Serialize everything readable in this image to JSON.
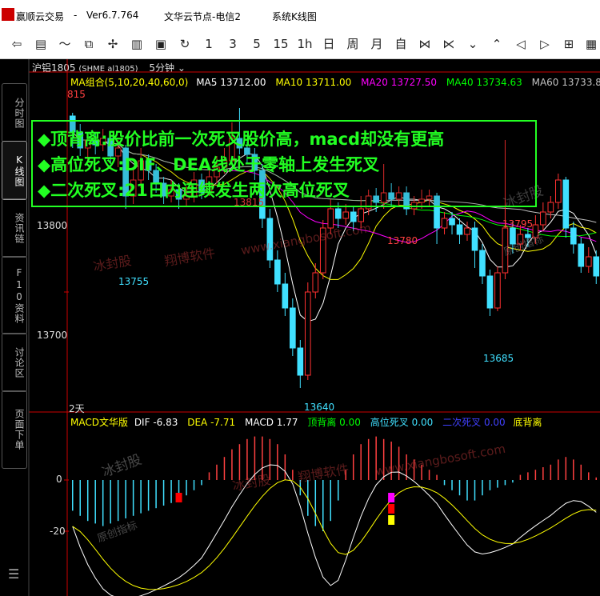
{
  "window": {
    "app_title": "赢顺云交易",
    "separator": "-",
    "version": "Ver6.7.764",
    "node": "文华云节点-电信2",
    "subtitle": "系统K线图"
  },
  "toolbar": {
    "items": [
      "back-icon",
      "list-icon",
      "line-icon",
      "candle-icon",
      "cross-icon",
      "bar-icon",
      "save-icon",
      "refresh-icon",
      "1",
      "3",
      "5",
      "15",
      "1h",
      "日",
      "周",
      "月",
      "自",
      "zoom-out-icon",
      "zoom-in-icon",
      "collapse-icon",
      "expand-icon",
      "left-icon",
      "right-icon",
      "grid-icon",
      "grid2-icon"
    ],
    "labels": {
      "p1": "1",
      "p3": "3",
      "p5": "5",
      "p15": "15",
      "p1h": "1h",
      "day": "日",
      "week": "周",
      "month": "月",
      "custom": "自"
    }
  },
  "sidebar": {
    "tabs": [
      {
        "label": "分时图"
      },
      {
        "label": "K线图"
      },
      {
        "label": "资讯链"
      },
      {
        "label": "F10资料"
      },
      {
        "label": "讨论区"
      },
      {
        "label": "页面下单"
      }
    ]
  },
  "contract": {
    "name": "沪铝1805",
    "code": "(SHME al1805)",
    "period": "5分钟"
  },
  "ma_header": {
    "group": "MA组合(5,10,20,40,60,0)",
    "ma5_label": "MA5",
    "ma5": "13712.00",
    "ma10_label": "MA10",
    "ma10": "13711.00",
    "ma20_label": "MA20",
    "ma20": "13727.50",
    "ma40_label": "MA40",
    "ma40": "13734.63",
    "ma60_label": "MA60",
    "ma60": "13733.83",
    "colors": {
      "ma5": "#ffffff",
      "ma10": "#ffff00",
      "ma20": "#ff00ff",
      "ma40": "#00ff00",
      "ma60": "#c0c0c0"
    }
  },
  "callout": {
    "line1": "◆顶背离:股价比前一次死叉股价高，macd却没有更高",
    "line2": "◆高位死叉:DIF、DEA线处于零轴上发生死叉",
    "line3": "◆二次死叉:21日内连续发生两次高位死叉"
  },
  "price_axis": {
    "tick1": "13800",
    "tick2": "13700"
  },
  "annotations": {
    "p1": "13755",
    "p2": "13815",
    "p3": "13780",
    "p4": "13795",
    "p5": "13685",
    "p6": "13640",
    "p0": "815",
    "days": "2天"
  },
  "watermark": {
    "brand": "冰封股",
    "sub": "翔博软件",
    "url": "www.xiangbosoft.com",
    "seal": "冰封股",
    "seal_sub": "原创指标"
  },
  "macd_header": {
    "name": "MACD文华版",
    "dif_label": "DIF",
    "dif": "-6.83",
    "dea_label": "DEA",
    "dea": "-7.71",
    "macd_label": "MACD",
    "macd": "1.77",
    "top_div_label": "顶背离",
    "top_div": "0.00",
    "high_death_label": "高位死叉",
    "high_death": "0.00",
    "second_death_label": "二次死叉",
    "second_death": "0.00",
    "bottom_div_label": "底背离"
  },
  "macd_axis": {
    "zero": "0",
    "neg20": "-20"
  },
  "chart_data": {
    "type": "candlestick",
    "ylim": [
      13630,
      13830
    ],
    "candles": [
      [
        13810,
        13800,
        13812,
        13790
      ],
      [
        13800,
        13790,
        13805,
        13785
      ],
      [
        13790,
        13795,
        13798,
        13782
      ],
      [
        13795,
        13792,
        13800,
        13786
      ],
      [
        13792,
        13796,
        13802,
        13788
      ],
      [
        13796,
        13785,
        13800,
        13780
      ],
      [
        13785,
        13790,
        13795,
        13778
      ],
      [
        13790,
        13760,
        13792,
        13752
      ],
      [
        13760,
        13770,
        13778,
        13755
      ],
      [
        13770,
        13782,
        13790,
        13765
      ],
      [
        13782,
        13776,
        13786,
        13770
      ],
      [
        13776,
        13768,
        13780,
        13762
      ],
      [
        13768,
        13760,
        13772,
        13755
      ],
      [
        13760,
        13764,
        13770,
        13756
      ],
      [
        13764,
        13758,
        13768,
        13752
      ],
      [
        13758,
        13760,
        13766,
        13754
      ],
      [
        13760,
        13770,
        13775,
        13756
      ],
      [
        13770,
        13762,
        13774,
        13758
      ],
      [
        13762,
        13772,
        13778,
        13760
      ],
      [
        13772,
        13778,
        13785,
        13768
      ],
      [
        13778,
        13782,
        13790,
        13774
      ],
      [
        13782,
        13796,
        13806,
        13780
      ],
      [
        13796,
        13790,
        13815,
        13786
      ],
      [
        13790,
        13786,
        13794,
        13780
      ],
      [
        13786,
        13776,
        13790,
        13770
      ],
      [
        13776,
        13746,
        13780,
        13740
      ],
      [
        13746,
        13720,
        13752,
        13715
      ],
      [
        13720,
        13705,
        13726,
        13700
      ],
      [
        13705,
        13690,
        13712,
        13685
      ],
      [
        13690,
        13665,
        13696,
        13660
      ],
      [
        13665,
        13648,
        13670,
        13640
      ],
      [
        13648,
        13700,
        13706,
        13645
      ],
      [
        13700,
        13712,
        13718,
        13696
      ],
      [
        13712,
        13740,
        13745,
        13708
      ],
      [
        13740,
        13752,
        13758,
        13736
      ],
      [
        13752,
        13746,
        13756,
        13740
      ],
      [
        13746,
        13750,
        13755,
        13742
      ],
      [
        13750,
        13744,
        13754,
        13738
      ],
      [
        13744,
        13752,
        13760,
        13740
      ],
      [
        13752,
        13760,
        13764,
        13748
      ],
      [
        13760,
        13756,
        13765,
        13750
      ],
      [
        13756,
        13762,
        13780,
        13752
      ],
      [
        13762,
        13758,
        13768,
        13754
      ],
      [
        13758,
        13762,
        13766,
        13754
      ],
      [
        13762,
        13752,
        13766,
        13748
      ],
      [
        13752,
        13756,
        13760,
        13748
      ],
      [
        13756,
        13758,
        13764,
        13752
      ],
      [
        13758,
        13760,
        13764,
        13754
      ],
      [
        13760,
        13740,
        13762,
        13730
      ],
      [
        13740,
        13746,
        13750,
        13736
      ],
      [
        13746,
        13742,
        13750,
        13736
      ],
      [
        13742,
        13736,
        13746,
        13730
      ],
      [
        13736,
        13740,
        13744,
        13732
      ],
      [
        13740,
        13726,
        13744,
        13715
      ],
      [
        13726,
        13710,
        13730,
        13705
      ],
      [
        13710,
        13690,
        13714,
        13685
      ],
      [
        13690,
        13712,
        13716,
        13688
      ],
      [
        13712,
        13740,
        13795,
        13708
      ],
      [
        13740,
        13730,
        13744,
        13724
      ],
      [
        13730,
        13736,
        13742,
        13726
      ],
      [
        13736,
        13734,
        13740,
        13728
      ],
      [
        13734,
        13742,
        13748,
        13730
      ],
      [
        13742,
        13750,
        13756,
        13738
      ],
      [
        13750,
        13756,
        13760,
        13746
      ],
      [
        13756,
        13770,
        13774,
        13752
      ],
      [
        13770,
        13740,
        13772,
        13734
      ],
      [
        13740,
        13730,
        13744,
        13724
      ],
      [
        13730,
        13716,
        13734,
        13712
      ],
      [
        13716,
        13722,
        13728,
        13712
      ],
      [
        13722,
        13710,
        13726,
        13705
      ]
    ],
    "macd_bars": [
      -12,
      -14,
      -16,
      -17,
      -18,
      -17,
      -16,
      -15,
      -14,
      -13,
      -12,
      -11,
      -10,
      -9,
      -8,
      -6,
      -4,
      -2,
      3,
      6,
      9,
      12,
      14,
      16,
      17,
      17,
      16,
      14,
      10,
      4,
      -6,
      -14,
      -18,
      -20,
      -16,
      -8,
      4,
      10,
      14,
      16,
      17,
      16,
      15,
      13,
      10,
      8,
      6,
      4,
      2,
      -2,
      -4,
      -6,
      -8,
      -8,
      -6,
      -4,
      -3,
      -2,
      -1,
      2,
      3,
      4,
      5,
      6,
      8,
      9,
      8,
      6,
      3,
      1
    ],
    "signals": [
      {
        "bar": 14,
        "color": "#ff0000"
      },
      {
        "bar": 42,
        "color": "#ff00ff"
      },
      {
        "bar": 42,
        "color": "#ff0000"
      },
      {
        "bar": 42,
        "color": "#ffff00"
      },
      {
        "bar": 71,
        "color": "#ff0000"
      }
    ]
  }
}
